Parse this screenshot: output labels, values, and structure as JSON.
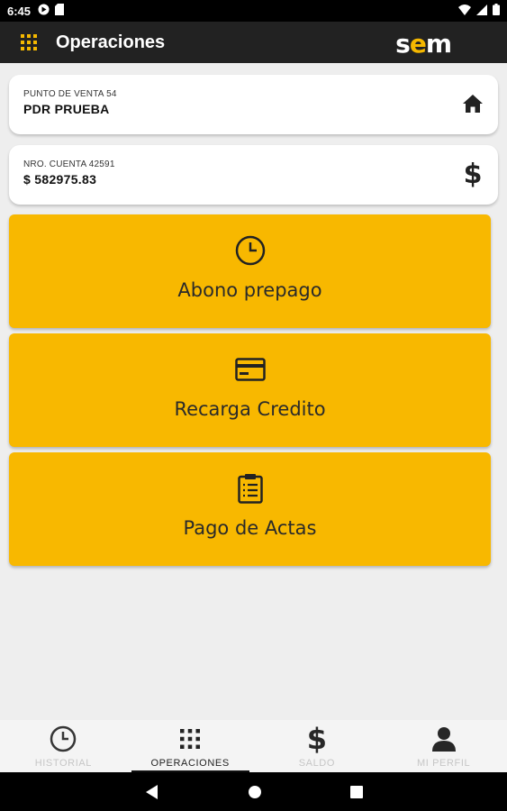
{
  "status_bar": {
    "time": "6:45",
    "icons": [
      "google-play-icon",
      "sd-card-icon",
      "wifi-icon",
      "cell-signal-icon",
      "battery-icon"
    ]
  },
  "app_bar": {
    "title": "Operaciones",
    "logo_text_a": "s",
    "logo_text_e": "e",
    "logo_text_b": "m",
    "menu_icon": "grid-icon"
  },
  "cards": {
    "punto_venta": {
      "label": "PUNTO DE VENTA 54",
      "value": "PDR PRUEBA",
      "icon": "home-icon"
    },
    "cuenta": {
      "label": "NRO. CUENTA 42591",
      "value": "$ 582975.83",
      "icon": "dollar-icon",
      "icon_glyph": "$"
    }
  },
  "tiles": [
    {
      "label": "Abono prepago",
      "icon": "clock-icon"
    },
    {
      "label": "Recarga Credito",
      "icon": "credit-card-icon"
    },
    {
      "label": "Pago de Actas",
      "icon": "clipboard-icon"
    }
  ],
  "bottom_nav": {
    "items": [
      {
        "label": "HISTORIAL",
        "icon": "clock-icon",
        "active": false
      },
      {
        "label": "OPERACIONES",
        "icon": "grid-icon",
        "active": true
      },
      {
        "label": "SALDO",
        "icon": "dollar-icon",
        "active": false,
        "glyph": "$"
      },
      {
        "label": "MI PERFIL",
        "icon": "person-icon",
        "active": false
      }
    ]
  },
  "system_nav": [
    "back-icon",
    "home-circle-icon",
    "recents-icon"
  ],
  "colors": {
    "accent": "#f8b800",
    "app_bar": "#222222",
    "background": "#eeeeee"
  }
}
